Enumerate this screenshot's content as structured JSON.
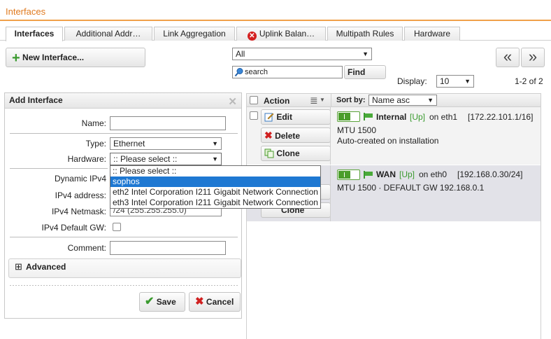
{
  "page": {
    "title": "Interfaces"
  },
  "tabs": [
    {
      "label": "Interfaces",
      "active": true
    },
    {
      "label": "Additional Addr…"
    },
    {
      "label": "Link Aggregation"
    },
    {
      "label": "Uplink Balan…",
      "error": true,
      "error_glyph": "✕"
    },
    {
      "label": "Multipath Rules"
    },
    {
      "label": "Hardware"
    }
  ],
  "toolbar": {
    "new_label": "New Interface...",
    "filter_value": "All",
    "search_placeholder": "search",
    "find_label": "Find",
    "display_label": "Display:",
    "display_value": "10",
    "pager_text": "1-2 of 2",
    "prev_glyph": "«",
    "next_glyph": "»"
  },
  "form": {
    "title": "Add Interface",
    "close_glyph": "✕",
    "name_label": "Name:",
    "name_value": "",
    "type_label": "Type:",
    "type_value": "Ethernet",
    "hardware_label": "Hardware:",
    "hardware_value": ":: Please select ::",
    "dynamic_label": "Dynamic IPv4",
    "ipv4_address_label": "IPv4 address:",
    "netmask_label": "IPv4 Netmask:",
    "netmask_value": "/24 (255.255.255.0)",
    "defaultgw_label": "IPv4 Default GW:",
    "comment_label": "Comment:",
    "comment_value": "",
    "advanced_label": "Advanced",
    "expand_glyph": "⊞",
    "save_label": "Save",
    "cancel_label": "Cancel",
    "save_glyph": "✔",
    "cancel_glyph": "✖"
  },
  "hardware_options": [
    ":: Please select ::",
    "sophos",
    "eth2 Intel Corporation I211 Gigabit Network Connection",
    "eth3 Intel Corporation I211 Gigabit Network Connection"
  ],
  "grid": {
    "action_label": "Action",
    "sortby_label": "Sort by:",
    "sort_value": "Name asc",
    "list_glyph": "≣",
    "rows": [
      {
        "name": "Internal",
        "status": "[Up]",
        "on_text": "on eth1",
        "address": "[172.22.101.1/16]",
        "mtu": "MTU 1500",
        "comment": "Auto-created on installation",
        "edit": "Edit",
        "delete": "Delete",
        "clone": "Clone"
      },
      {
        "name": "WAN",
        "status": "[Up]",
        "on_text": "on eth0",
        "address": "[192.168.0.30/24]",
        "mtu": "MTU 1500 · DEFAULT GW 192.168.0.1",
        "clone": "Clone"
      }
    ]
  },
  "colors": {
    "accent": "#e07a1f",
    "ok_green": "#3a9a2e",
    "selection_blue": "#1e78d2",
    "error_red": "#d42020"
  }
}
